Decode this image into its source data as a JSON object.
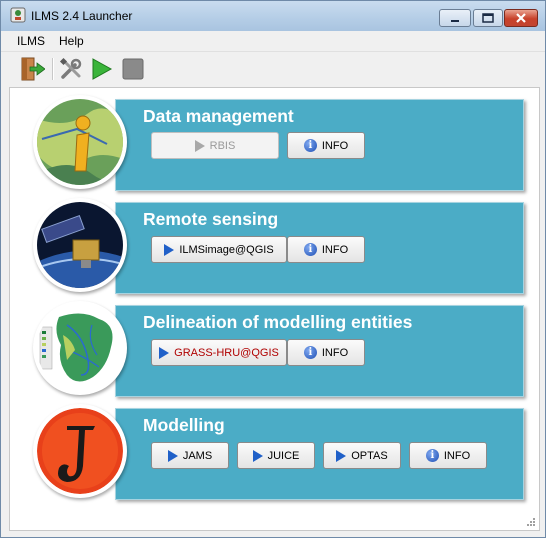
{
  "window": {
    "title": "ILMS 2.4 Launcher"
  },
  "menu": {
    "items": [
      "ILMS",
      "Help"
    ]
  },
  "toolbar": {
    "icons": [
      "exit-door-icon",
      "tools-icon",
      "play-icon",
      "stop-icon"
    ]
  },
  "colors": {
    "panel": "#4bacc6",
    "play": "#2060c8",
    "info": "#1e4fb4"
  },
  "sections": [
    {
      "title": "Data management",
      "buttons": [
        {
          "label": "RBIS",
          "enabled": false
        },
        {
          "label": "INFO",
          "enabled": true
        }
      ]
    },
    {
      "title": "Remote sensing",
      "buttons": [
        {
          "label": "ILMSimage@QGIS",
          "enabled": true
        },
        {
          "label": "INFO",
          "enabled": true
        }
      ]
    },
    {
      "title": "Delineation of modelling entities",
      "buttons": [
        {
          "label": "GRASS-HRU@QGIS",
          "enabled": true
        },
        {
          "label": "INFO",
          "enabled": true
        }
      ]
    },
    {
      "title": "Modelling",
      "buttons": [
        {
          "label": "JAMS",
          "enabled": true
        },
        {
          "label": "JUICE",
          "enabled": true
        },
        {
          "label": "OPTAS",
          "enabled": true
        },
        {
          "label": "INFO",
          "enabled": true
        }
      ]
    }
  ]
}
